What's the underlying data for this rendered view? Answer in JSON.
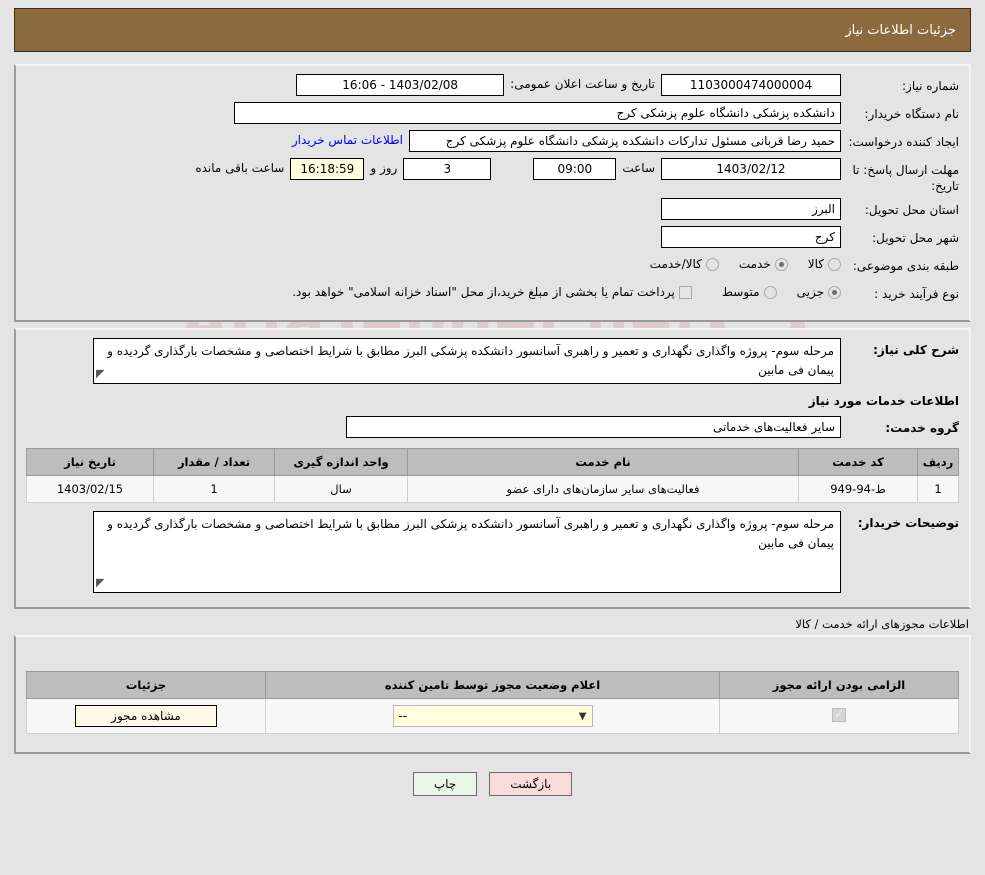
{
  "header": {
    "title": "جزئیات اطلاعات نیاز"
  },
  "form": {
    "need_number_label": "شماره نیاز:",
    "need_number_value": "1103000474000004",
    "announce_label": "تاریخ و ساعت اعلان عمومی:",
    "announce_value": "1403/02/08 - 16:06",
    "buyer_org_label": "نام دستگاه خریدار:",
    "buyer_org_value": "دانشکده پزشکی دانشگاه علوم پزشکی کرج",
    "requester_label": "ایجاد کننده درخواست:",
    "requester_value": "حمید رضا قربانی مسئول تدارکات دانشکده پزشکی دانشگاه علوم پزشکی کرج",
    "contact_link": "اطلاعات تماس خریدار",
    "deadline_label": "مهلت ارسال پاسخ: تا تاریخ:",
    "deadline_date": "1403/02/12",
    "time_word": "ساعت",
    "deadline_time": "09:00",
    "days_remaining": "3",
    "days_word": "روز و",
    "time_remaining": "16:18:59",
    "remaining_suffix": "ساعت باقی مانده",
    "province_label": "استان محل تحویل:",
    "province_value": "البرز",
    "city_label": "شهر محل تحویل:",
    "city_value": "کرج",
    "category_label": "طبقه بندی موضوعی:",
    "category_options": [
      {
        "label": "کالا",
        "selected": false
      },
      {
        "label": "خدمت",
        "selected": true
      },
      {
        "label": "کالا/خدمت",
        "selected": false
      }
    ],
    "process_label": "نوع فرآیند خرید :",
    "process_options": [
      {
        "label": "جزیی",
        "selected": true
      },
      {
        "label": "متوسط",
        "selected": false
      }
    ],
    "treasury_checkbox_label": "پرداخت تمام یا بخشی از مبلغ خرید،از محل \"اسناد خزانه اسلامی\" خواهد بود.",
    "treasury_checked": false,
    "general_desc_label": "شرح کلی نیاز:",
    "general_desc_value": "مرحله سوم- پروژه واگذاری نگهداری و تعمیر و راهبری آسانسور دانشکده پزشکی البرز مطابق با شرایط اختصاصی و مشخصات بارگذاری گردیده و پیمان فی مابین",
    "services_section_title": "اطلاعات خدمات مورد نیاز",
    "service_group_label": "گروه خدمت:",
    "service_group_value": "سایر فعالیت‌های خدماتی",
    "buyer_notes_label": "توضیحات خریدار:",
    "buyer_notes_value": "مرحله سوم- پروژه واگذاری نگهداری و تعمیر و راهبری آسانسور دانشکده پزشکی البرز مطابق با شرایط اختصاصی و مشخصات بارگذاری گردیده و پیمان فی مابین"
  },
  "services_table": {
    "headers": [
      "ردیف",
      "کد خدمت",
      "نام خدمت",
      "واحد اندازه گیری",
      "تعداد / مقدار",
      "تاریخ نیاز"
    ],
    "rows": [
      {
        "row": "1",
        "code": "ط-94-949",
        "name": "فعالیت‌های سایر سازمان‌های دارای عضو",
        "unit": "سال",
        "quantity": "1",
        "need_date": "1403/02/15"
      }
    ]
  },
  "permits": {
    "section_note": "اطلاعات مجوزهای ارائه خدمت / کالا",
    "headers": [
      "الزامی بودن ارائه مجوز",
      "اعلام وضعیت مجوز توسط تامین کننده",
      "جزئیات"
    ],
    "rows": [
      {
        "required_checked": true,
        "status_value": "--",
        "details_button": "مشاهده مجوز"
      }
    ]
  },
  "footer": {
    "back_button": "بازگشت",
    "print_button": "چاپ"
  },
  "watermark": {
    "text": "AriaTender.net"
  },
  "colors": {
    "header_bg": "#8b6a3d",
    "link": "#0000ee",
    "back_btn": "#fbdada",
    "print_btn": "#e9f7e9",
    "cream": "#fdfbe8",
    "table_header": "#bdbdbd"
  }
}
